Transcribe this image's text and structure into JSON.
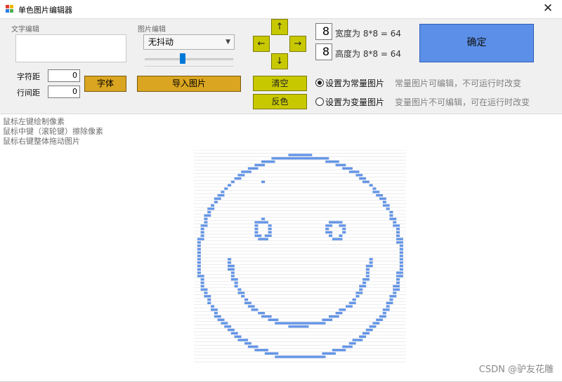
{
  "window": {
    "title": "单色图片编辑器",
    "close_glyph": "✕"
  },
  "text_edit": {
    "label": "文字编辑",
    "value": "",
    "char_spacing_label": "字符距",
    "char_spacing_value": "0",
    "line_spacing_label": "行间距",
    "line_spacing_value": "0",
    "font_button": "字体"
  },
  "image_edit": {
    "label": "图片编辑",
    "dither_selected": "无抖动",
    "threshold_level": 0.42,
    "import_button": "导入图片"
  },
  "move": {
    "up": "↑",
    "left": "←",
    "right": "→",
    "down": "↓",
    "clear_button": "清空",
    "invert_button": "反色"
  },
  "size": {
    "width_value": "8",
    "width_text": "宽度为 8*8 = 64",
    "height_value": "8",
    "height_text": "高度为 8*8 = 64"
  },
  "mode": {
    "constant_label": "设置为常量图片",
    "constant_hint": "常量图片可编辑，不可运行时改变",
    "variable_label": "设置为变量图片",
    "variable_hint": "变量图片不可编辑，可在运行时改变",
    "selected": "constant"
  },
  "confirm_button": "确定",
  "help": {
    "line1": "鼠标左键绘制像素",
    "line2": "鼠标中键（滚轮键）擦除像素",
    "line3": "鼠标右键整体拖动图片"
  },
  "canvas": {
    "pixel_color": "#6495e6",
    "grid_color": "#a9a9a9",
    "icon": "smiley-face-icon"
  },
  "watermark": "CSDN @驴友花雕"
}
